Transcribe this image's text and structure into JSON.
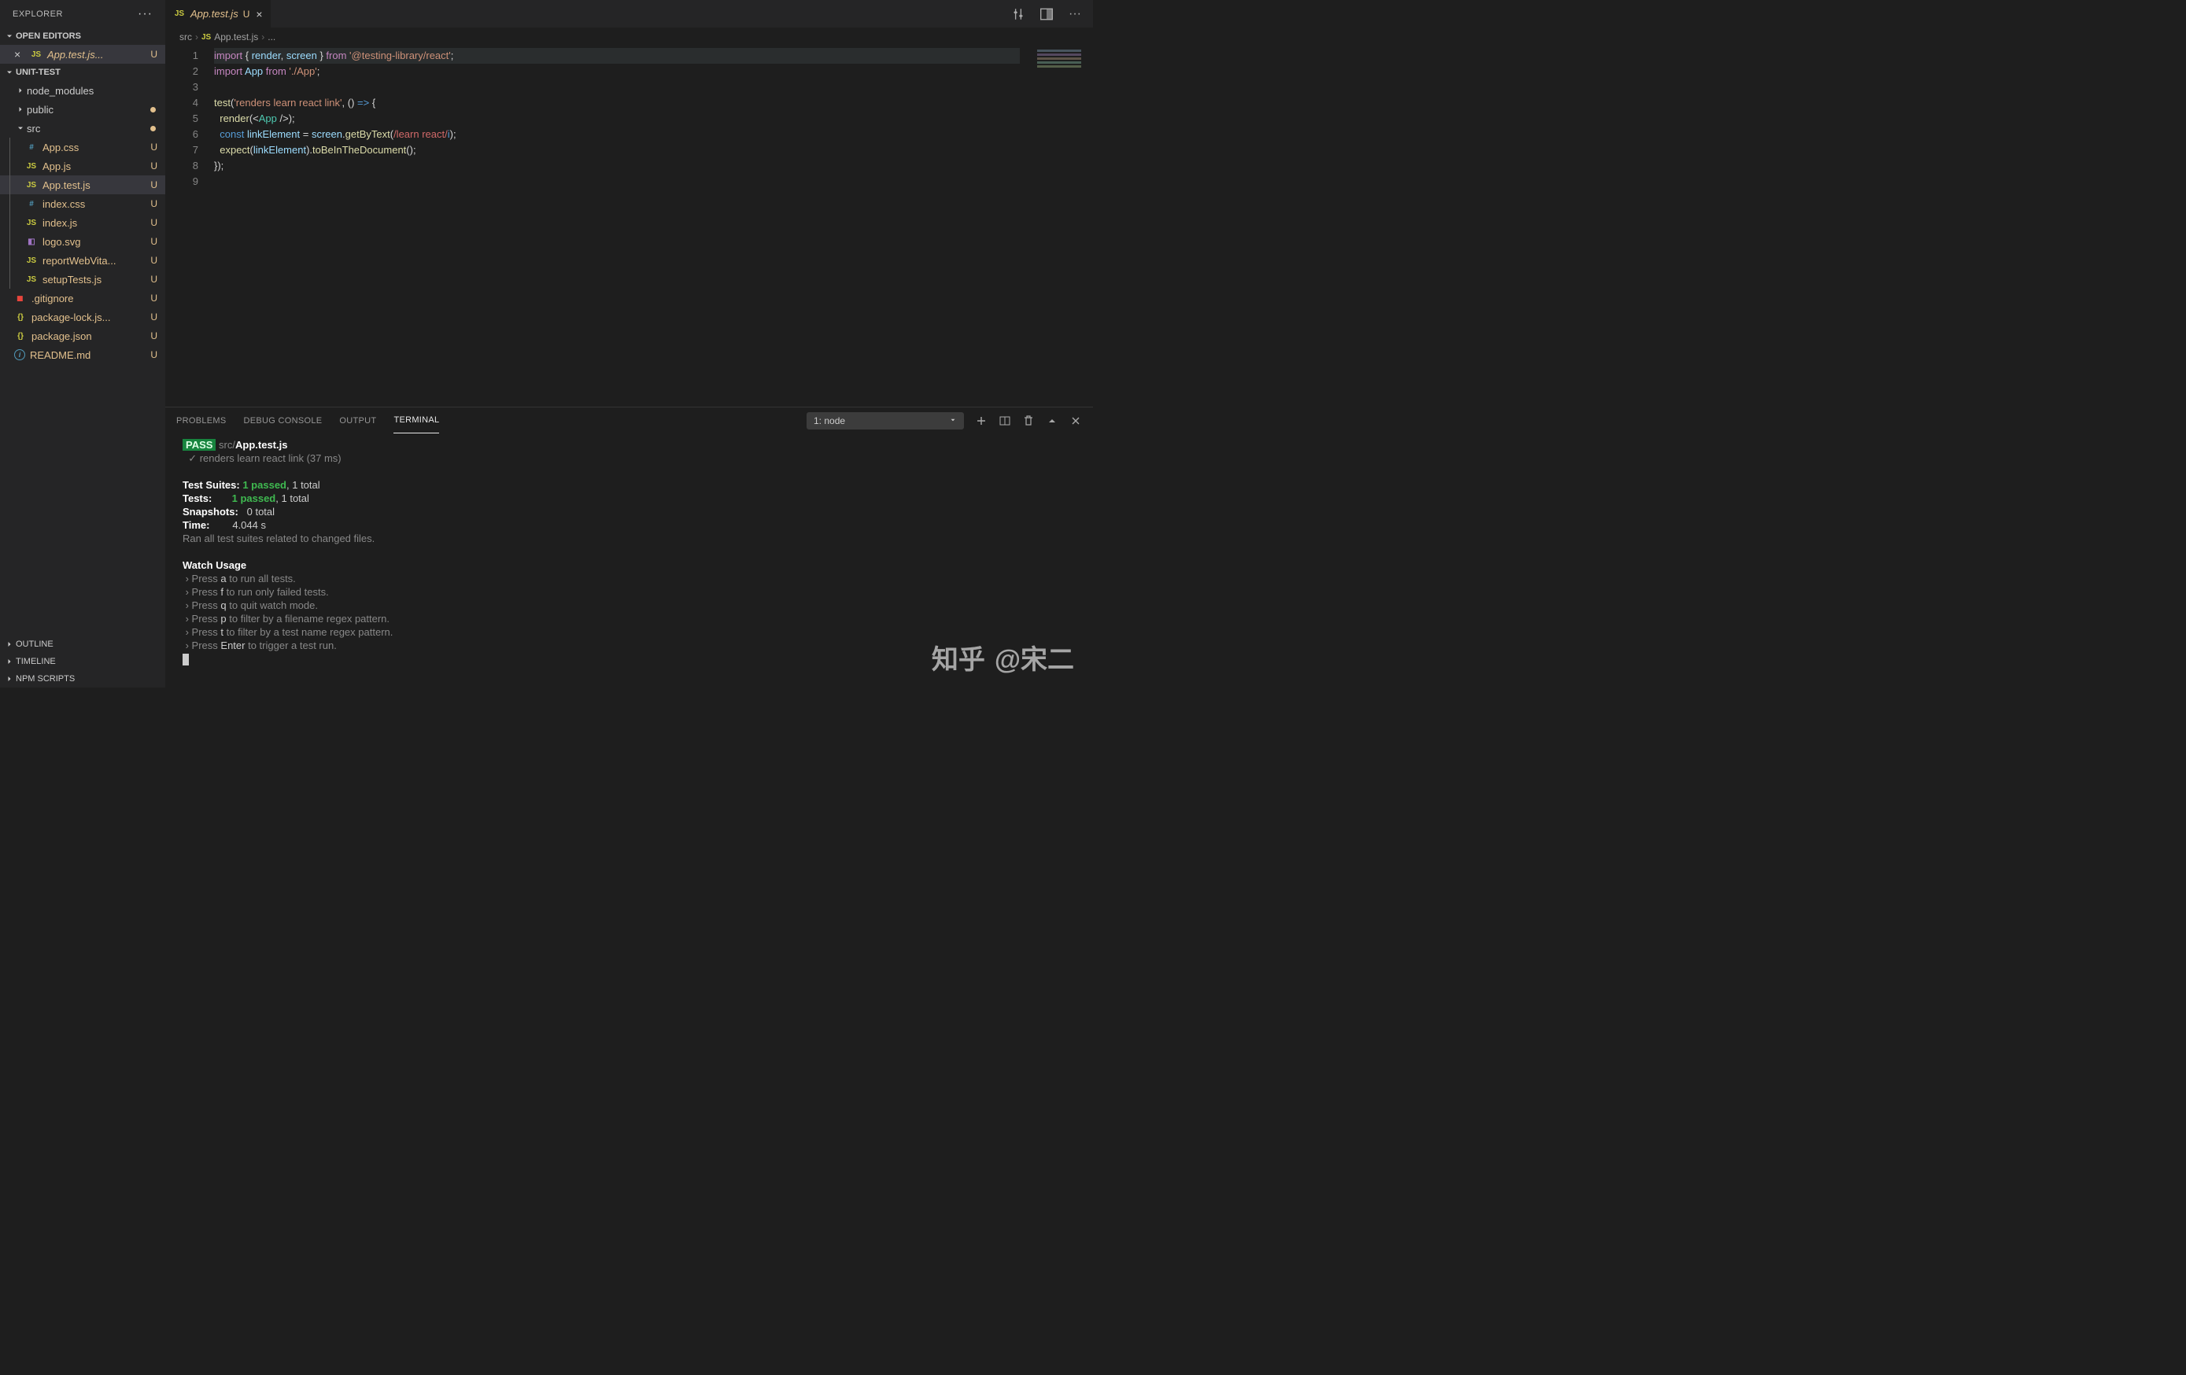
{
  "explorer": {
    "title": "EXPLORER",
    "open_editors": {
      "label": "OPEN EDITORS",
      "item": {
        "name": "App.test.js...",
        "status": "U",
        "icon": "JS"
      }
    },
    "workspace": {
      "label": "UNIT-TEST",
      "tree": [
        {
          "name": "node_modules",
          "kind": "folder",
          "indent": 1,
          "expanded": false
        },
        {
          "name": "public",
          "kind": "folder",
          "indent": 1,
          "expanded": false,
          "modified": true
        },
        {
          "name": "src",
          "kind": "folder",
          "indent": 1,
          "expanded": true,
          "modified": true
        },
        {
          "name": "App.css",
          "kind": "css",
          "indent": 2,
          "status": "U",
          "mod": true
        },
        {
          "name": "App.js",
          "kind": "js",
          "indent": 2,
          "status": "U",
          "mod": true
        },
        {
          "name": "App.test.js",
          "kind": "js",
          "indent": 2,
          "status": "U",
          "mod": true,
          "active": true
        },
        {
          "name": "index.css",
          "kind": "css",
          "indent": 2,
          "status": "U",
          "mod": true
        },
        {
          "name": "index.js",
          "kind": "js",
          "indent": 2,
          "status": "U",
          "mod": true
        },
        {
          "name": "logo.svg",
          "kind": "svg",
          "indent": 2,
          "status": "U",
          "mod": true
        },
        {
          "name": "reportWebVita...",
          "kind": "js",
          "indent": 2,
          "status": "U",
          "mod": true
        },
        {
          "name": "setupTests.js",
          "kind": "js",
          "indent": 2,
          "status": "U",
          "mod": true
        },
        {
          "name": ".gitignore",
          "kind": "git",
          "indent": 1,
          "status": "U",
          "mod": true
        },
        {
          "name": "package-lock.js...",
          "kind": "json",
          "indent": 1,
          "status": "U",
          "mod": true
        },
        {
          "name": "package.json",
          "kind": "json",
          "indent": 1,
          "status": "U",
          "mod": true
        },
        {
          "name": "README.md",
          "kind": "md",
          "indent": 1,
          "status": "U",
          "mod": true
        }
      ]
    },
    "sections": {
      "outline": "OUTLINE",
      "timeline": "TIMELINE",
      "npm_scripts": "NPM SCRIPTS"
    }
  },
  "editor": {
    "tab": {
      "name": "App.test.js",
      "status": "U"
    },
    "breadcrumb": {
      "p1": "src",
      "p2": "App.test.js",
      "p3": "..."
    },
    "line_numbers": [
      "1",
      "2",
      "3",
      "4",
      "5",
      "6",
      "7",
      "8",
      "9"
    ],
    "code": {
      "l1": {
        "a": "import",
        "b": " { ",
        "c": "render",
        "d": ", ",
        "e": "screen",
        "f": " } ",
        "g": "from",
        "h": " ",
        "i": "'@testing-library/react'",
        "j": ";"
      },
      "l2": {
        "a": "import",
        "b": " ",
        "c": "App",
        "d": " ",
        "e": "from",
        "f": " ",
        "g": "'./App'",
        "h": ";"
      },
      "l4": {
        "a": "test",
        "b": "(",
        "c": "'renders learn react link'",
        "d": ", () ",
        "e": "=>",
        "f": " {"
      },
      "l5": {
        "a": "  ",
        "b": "render",
        "c": "(<",
        "d": "App",
        "e": " />);"
      },
      "l6": {
        "a": "  ",
        "b": "const",
        "c": " ",
        "d": "linkElement",
        "e": " = ",
        "f": "screen",
        "g": ".",
        "h": "getByText",
        "i": "(",
        "j": "/learn react/",
        "k": "i",
        "l": ");"
      },
      "l7": {
        "a": "  ",
        "b": "expect",
        "c": "(",
        "d": "linkElement",
        "e": ").",
        "f": "toBeInTheDocument",
        "g": "();"
      },
      "l8": {
        "a": "});"
      }
    }
  },
  "panel": {
    "tabs": {
      "problems": "PROBLEMS",
      "debug": "DEBUG CONSOLE",
      "output": "OUTPUT",
      "terminal": "TERMINAL"
    },
    "select": "1: node",
    "terminal": {
      "pass": "PASS",
      "path_dim": " src/",
      "path_bold": "App.test.js",
      "check": "  ✓ renders learn react link (37 ms)",
      "suites": {
        "label": "Test Suites: ",
        "pass": "1 passed",
        "rest": ", 1 total"
      },
      "tests": {
        "label": "Tests:       ",
        "pass": "1 passed",
        "rest": ", 1 total"
      },
      "snapshots": {
        "label": "Snapshots:   ",
        "val": "0 total"
      },
      "time": {
        "label": "Time:        ",
        "val": "4.044 s"
      },
      "ran": "Ran all test suites related to changed files.",
      "watch_hdr": "Watch Usage",
      "w1": {
        "pre": " › Press ",
        "key": "a",
        "post": " to run all tests."
      },
      "w2": {
        "pre": " › Press ",
        "key": "f",
        "post": " to run only failed tests."
      },
      "w3": {
        "pre": " › Press ",
        "key": "q",
        "post": " to quit watch mode."
      },
      "w4": {
        "pre": " › Press ",
        "key": "p",
        "post": " to filter by a filename regex pattern."
      },
      "w5": {
        "pre": " › Press ",
        "key": "t",
        "post": " to filter by a test name regex pattern."
      },
      "w6": {
        "pre": " › Press ",
        "key": "Enter",
        "post": " to trigger a test run."
      }
    }
  },
  "watermark": "@宋二"
}
